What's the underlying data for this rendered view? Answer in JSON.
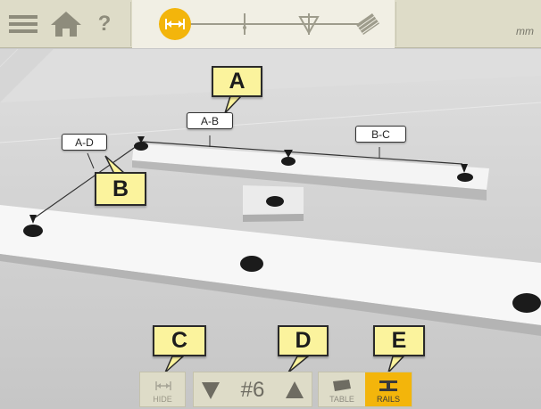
{
  "toolbar": {
    "help_label": "?",
    "unit": "mm",
    "steps": [
      "distance-icon",
      "point-icon",
      "level-icon",
      "stack-icon"
    ],
    "active_step": 0,
    "accent_color": "#f3b50b"
  },
  "scene": {
    "tags": {
      "ab": "A-B",
      "bc": "B-C",
      "ad": "A-D"
    },
    "callouts": {
      "a": "A",
      "b": "B",
      "c": "C",
      "d": "D",
      "e": "E"
    }
  },
  "bottom": {
    "hide_label": "HIDE",
    "nav_count": "#6",
    "table_label": "TABLE",
    "rails_label": "RAILS"
  }
}
